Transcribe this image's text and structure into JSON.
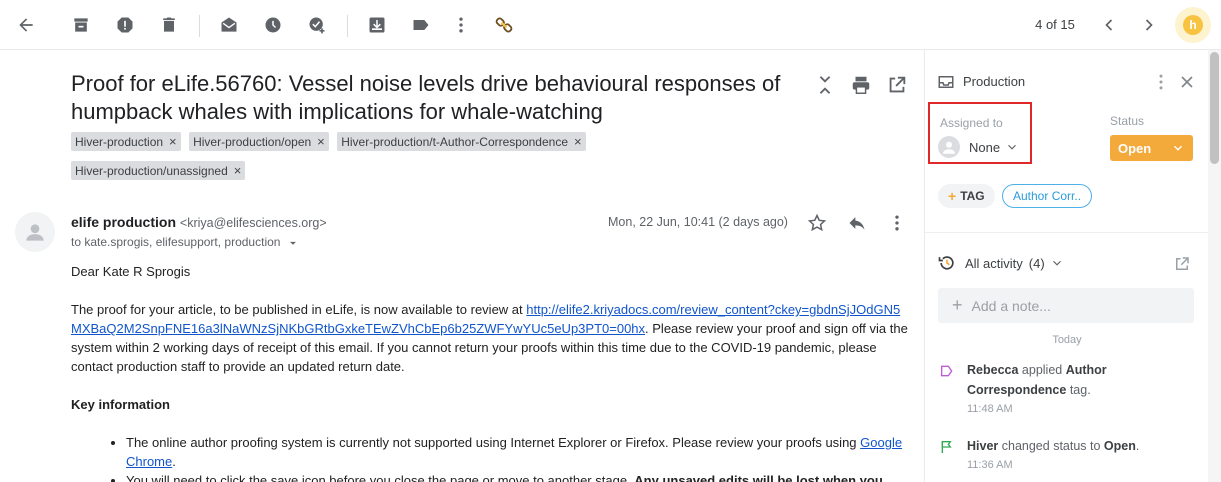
{
  "toolbar": {
    "pager": "4 of 15",
    "icons": [
      "back-arrow-icon",
      "archive-icon",
      "report-spam-icon",
      "delete-icon",
      "mark-unread-icon",
      "snooze-icon",
      "add-task-icon",
      "move-to-icon",
      "label-icon",
      "more-icon",
      "link-icon"
    ]
  },
  "email": {
    "subject": "Proof for eLife.56760: Vessel noise levels drive behavioural responses of humpback whales with implications for whale-watching",
    "labels": [
      "Hiver-production",
      "Hiver-production/open",
      "Hiver-production/t-Author-Correspondence",
      "Hiver-production/unassigned"
    ],
    "sender_name": "elife production",
    "sender_addr": "<kriya@elifesciences.org>",
    "recipients": "to kate.sprogis, elifesupport, production",
    "date": "Mon, 22 Jun, 10:41 (2 days ago)",
    "greeting": "Dear Kate R Sprogis",
    "para1_before": "The proof for your article, to be published in eLife, is now available to review at ",
    "para1_link": "http://elife2.kriyadocs.com/review_content?ckey=gbdnSjJOdGN5MXBaQ2M2SnpFNE16a3lNaWNzSjNKbGRtbGxkeTEwZVhCbEp6b25ZWFYwYUc5eUp3PT0=00hx",
    "para1_after": ". Please review your proof and sign off via the system within 2 working days of receipt of this email. If you cannot return your proofs within this time due to the COVID-19 pandemic, please contact production staff to provide an updated return date.",
    "key_heading": "Key information",
    "bullet1_before": "The online author proofing system is currently not supported using Internet Explorer or Firefox. Please review your proofs using ",
    "bullet1_link": "Google Chrome",
    "bullet1_after": ".",
    "bullet2_before": "You will need to click the save icon before you close the page or move to another stage. ",
    "bullet2_bold": "Any unsaved edits will be lost when you"
  },
  "panel": {
    "title": "Production",
    "assigned_label": "Assigned to",
    "assigned_value": "None",
    "status_label": "Status",
    "status_value": "Open",
    "status_color": "#f4a93b",
    "tag_button": "TAG",
    "tag_author": "Author Corr..",
    "activity_label": "All activity",
    "activity_count": "(4)",
    "note_placeholder": "Add a note...",
    "today": "Today",
    "activities": [
      {
        "actor": "Rebecca",
        "action": " applied ",
        "object": "Author Correspondence",
        "suffix": " tag.",
        "time": "11:48 AM"
      },
      {
        "actor": "Hiver",
        "action": " changed status to ",
        "object": "Open",
        "suffix": ".",
        "time": "11:36 AM"
      }
    ]
  }
}
